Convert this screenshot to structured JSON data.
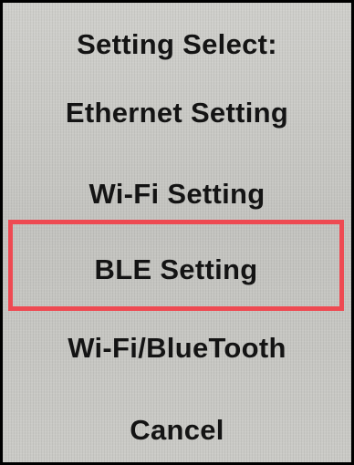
{
  "title": "Setting Select:",
  "menu": {
    "items": [
      {
        "label": "Ethernet Setting"
      },
      {
        "label": "Wi-Fi Setting"
      },
      {
        "label": "BLE Setting",
        "highlighted": true
      },
      {
        "label": "Wi-Fi/BlueTooth"
      },
      {
        "label": "Cancel"
      }
    ]
  },
  "colors": {
    "highlight_border": "#ee4a52",
    "screen_background": "#c6c6c2",
    "text": "#141414"
  }
}
